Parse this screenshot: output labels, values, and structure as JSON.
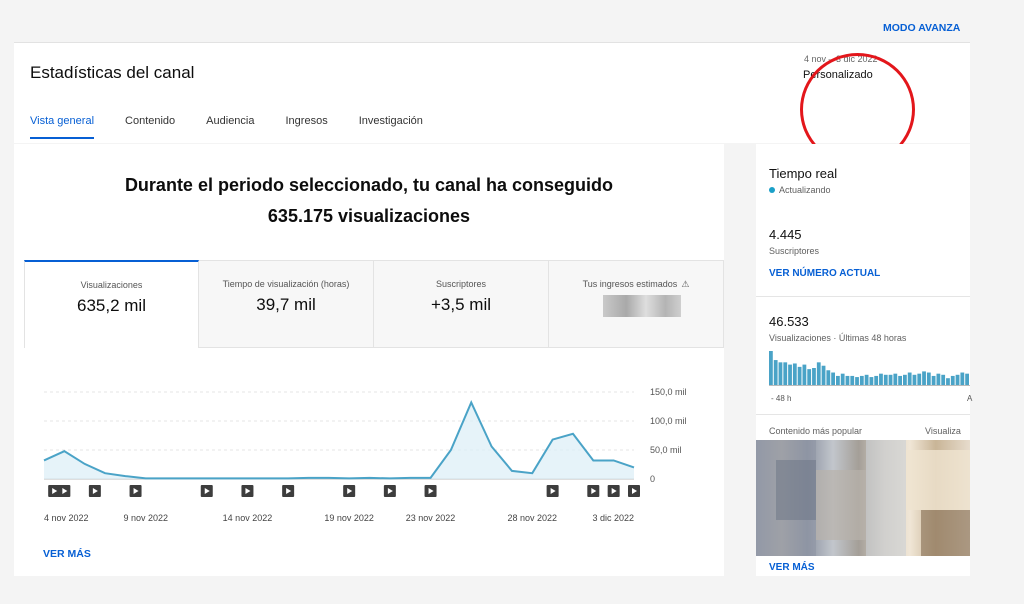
{
  "header": {
    "title": "Estadísticas del canal",
    "advanced_mode": "MODO AVANZA",
    "date_range": "4 nov – 3 dic 2022",
    "date_preset": "Personalizado"
  },
  "tabs": [
    {
      "label": "Vista general",
      "active": true
    },
    {
      "label": "Contenido",
      "active": false
    },
    {
      "label": "Audiencia",
      "active": false
    },
    {
      "label": "Ingresos",
      "active": false
    },
    {
      "label": "Investigación",
      "active": false
    }
  ],
  "summary": {
    "line1": "Durante el periodo seleccionado, tu canal ha conseguido",
    "line2": "635.175 visualizaciones"
  },
  "metrics": [
    {
      "label": "Visualizaciones",
      "value": "635,2 mil"
    },
    {
      "label": "Tiempo de visualización (horas)",
      "value": "39,7 mil"
    },
    {
      "label": "Suscriptores",
      "value": "+3,5 mil"
    },
    {
      "label": "Tus ingresos estimados",
      "value": ""
    }
  ],
  "icons": {
    "warning": "warning-icon",
    "video_marker": "play-icon"
  },
  "colors": {
    "accent": "#065fd4",
    "line": "#4aa3c7",
    "area": "#dbeef6",
    "highlight": "#e3161b"
  },
  "chart_data": {
    "type": "area",
    "x": [
      "4 nov",
      "5 nov",
      "6 nov",
      "7 nov",
      "8 nov",
      "9 nov",
      "10 nov",
      "11 nov",
      "12 nov",
      "13 nov",
      "14 nov",
      "15 nov",
      "16 nov",
      "17 nov",
      "18 nov",
      "19 nov",
      "20 nov",
      "21 nov",
      "22 nov",
      "23 nov",
      "24 nov",
      "25 nov",
      "26 nov",
      "27 nov",
      "28 nov",
      "29 nov",
      "30 nov",
      "1 dic",
      "2 dic",
      "3 dic"
    ],
    "values": [
      32,
      48,
      26,
      10,
      5,
      1,
      1,
      1,
      1,
      1,
      1,
      1,
      1,
      2,
      2,
      1,
      2,
      1,
      2,
      2,
      50,
      132,
      56,
      14,
      10,
      68,
      78,
      32,
      32,
      20
    ],
    "x_tick_labels": [
      "4 nov 2022",
      "9 nov 2022",
      "14 nov 2022",
      "19 nov 2022",
      "23 nov 2022",
      "28 nov 2022",
      "3 dic 2022"
    ],
    "x_tick_index": [
      0,
      5,
      10,
      15,
      19,
      24,
      29
    ],
    "y_ticks": [
      0,
      50,
      100,
      150
    ],
    "y_tick_labels": [
      "0",
      "50,0 mil",
      "100,0 mil",
      "150,0 mil"
    ],
    "ylim": [
      0,
      150
    ],
    "video_markers": [
      0.5,
      1,
      2.5,
      4.5,
      8,
      10,
      12,
      15,
      17,
      19,
      25,
      27,
      28,
      29
    ],
    "legend": "none",
    "grid": true
  },
  "chart_footer": {
    "more": "VER MÁS"
  },
  "realtime": {
    "title": "Tiempo real",
    "status": "Actualizando",
    "subs_value": "4.445",
    "subs_label": "Suscriptores",
    "subs_link": "VER NÚMERO ACTUAL",
    "views_value": "46.533",
    "views_label": "Visualizaciones · Últimas 48 horas",
    "hourly_views": [
      30,
      22,
      20,
      20,
      18,
      19,
      16,
      18,
      14,
      15,
      20,
      17,
      13,
      11,
      8,
      10,
      8,
      8,
      7,
      8,
      9,
      7,
      8,
      10,
      9,
      9,
      10,
      8,
      9,
      11,
      9,
      10,
      12,
      11,
      8,
      10,
      9,
      6,
      8,
      9,
      11,
      10
    ],
    "axis_start": "- 48 h",
    "axis_end": "A",
    "popular_label": "Contenido más popular",
    "popular_right": "Visualiza",
    "more": "VER MÁS"
  }
}
